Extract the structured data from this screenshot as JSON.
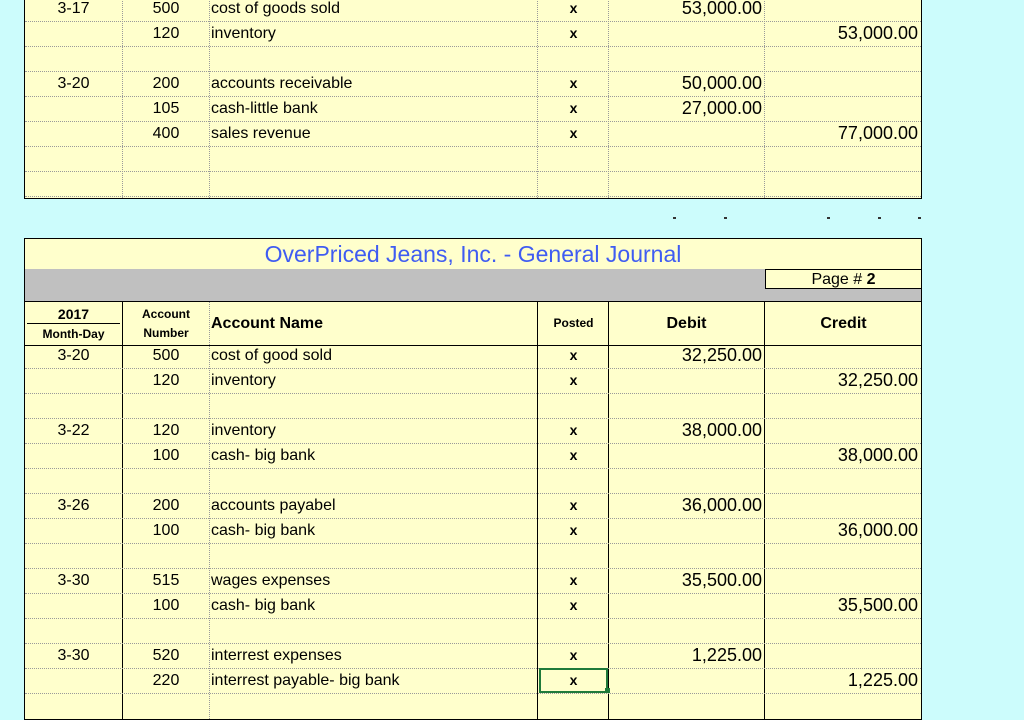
{
  "top_entries": [
    {
      "date": "3-17",
      "acct": "500",
      "name": "cost of goods sold",
      "posted": "x",
      "debit": "53,000.00",
      "credit": ""
    },
    {
      "date": "",
      "acct": "120",
      "name": "inventory",
      "posted": "x",
      "debit": "",
      "credit": "53,000.00"
    },
    {
      "date": "",
      "acct": "",
      "name": "",
      "posted": "",
      "debit": "",
      "credit": ""
    },
    {
      "date": "3-20",
      "acct": "200",
      "name": "accounts receivable",
      "posted": "x",
      "debit": "50,000.00",
      "credit": ""
    },
    {
      "date": "",
      "acct": "105",
      "name": "cash-little bank",
      "posted": "x",
      "debit": "27,000.00",
      "credit": ""
    },
    {
      "date": "",
      "acct": "400",
      "name": "sales revenue",
      "posted": "x",
      "debit": "",
      "credit": "77,000.00"
    },
    {
      "date": "",
      "acct": "",
      "name": "",
      "posted": "",
      "debit": "",
      "credit": ""
    },
    {
      "date": "",
      "acct": "",
      "name": "",
      "posted": "",
      "debit": "",
      "credit": ""
    }
  ],
  "journal": {
    "title": "OverPriced Jeans, Inc.  -  General Journal",
    "page_label": "Page #",
    "page_number": "2",
    "headers": {
      "year": "2017",
      "month_day": "Month-Day",
      "account": "Account",
      "number": "Number",
      "account_name": "Account Name",
      "posted": "Posted",
      "debit": "Debit",
      "credit": "Credit"
    }
  },
  "bottom_entries": [
    {
      "date": "3-20",
      "acct": "500",
      "name": "cost of good sold",
      "posted": "x",
      "debit": "32,250.00",
      "credit": ""
    },
    {
      "date": "",
      "acct": "120",
      "name": "inventory",
      "posted": "x",
      "debit": "",
      "credit": "32,250.00"
    },
    {
      "date": "",
      "acct": "",
      "name": "",
      "posted": "",
      "debit": "",
      "credit": ""
    },
    {
      "date": "3-22",
      "acct": "120",
      "name": "inventory",
      "posted": "x",
      "debit": "38,000.00",
      "credit": ""
    },
    {
      "date": "",
      "acct": "100",
      "name": "cash- big bank",
      "posted": "x",
      "debit": "",
      "credit": "38,000.00"
    },
    {
      "date": "",
      "acct": "",
      "name": "",
      "posted": "",
      "debit": "",
      "credit": ""
    },
    {
      "date": "3-26",
      "acct": "200",
      "name": "accounts payabel",
      "posted": "x",
      "debit": "36,000.00",
      "credit": ""
    },
    {
      "date": "",
      "acct": "100",
      "name": "cash- big bank",
      "posted": "x",
      "debit": "",
      "credit": "36,000.00"
    },
    {
      "date": "",
      "acct": "",
      "name": "",
      "posted": "",
      "debit": "",
      "credit": ""
    },
    {
      "date": "3-30",
      "acct": "515",
      "name": "wages expenses",
      "posted": "x",
      "debit": "35,500.00",
      "credit": ""
    },
    {
      "date": "",
      "acct": "100",
      "name": "cash- big bank",
      "posted": "x",
      "debit": "",
      "credit": "35,500.00"
    },
    {
      "date": "",
      "acct": "",
      "name": "",
      "posted": "",
      "debit": "",
      "credit": ""
    },
    {
      "date": "3-30",
      "acct": "520",
      "name": "interrest expenses",
      "posted": "x",
      "debit": "1,225.00",
      "credit": ""
    },
    {
      "date": "",
      "acct": "220",
      "name": "interrest payable- big bank",
      "posted": "x",
      "debit": "",
      "credit": "1,225.00"
    }
  ],
  "selected_cell": {
    "row": 13,
    "column": "posted"
  }
}
